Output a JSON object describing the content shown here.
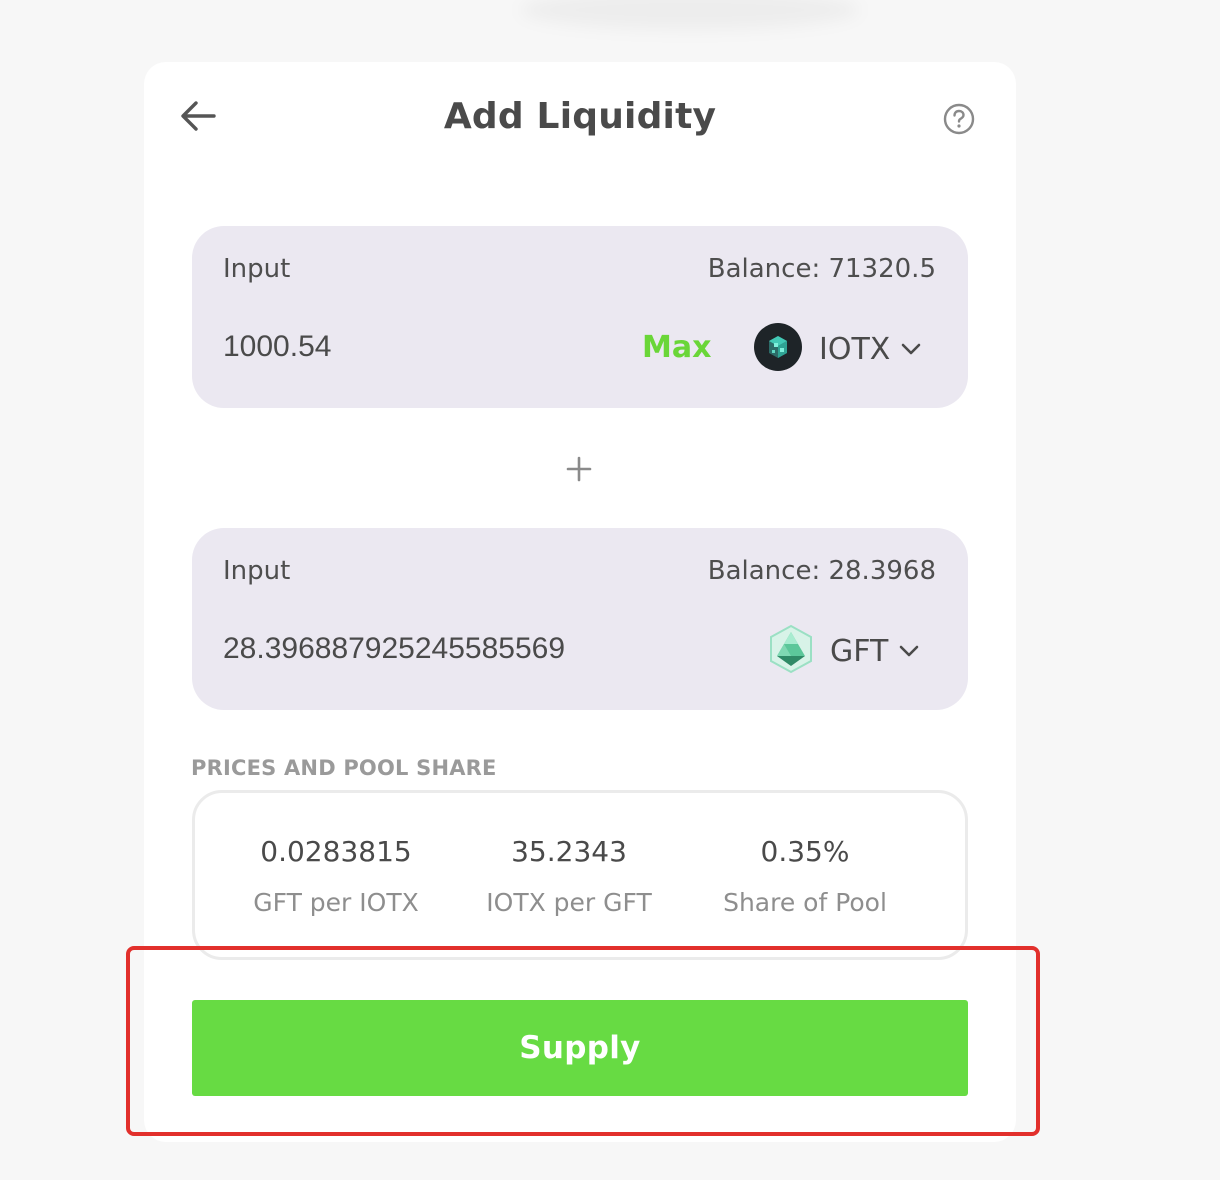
{
  "header": {
    "title": "Add Liquidity",
    "back_icon": "arrow-left-icon",
    "help_icon": "question-circle-icon"
  },
  "input_a": {
    "label": "Input",
    "balance": "Balance: 71320.5",
    "value": "1000.54",
    "max_label": "Max",
    "token": "IOTX",
    "token_icon": "iotx-token-icon"
  },
  "input_b": {
    "label": "Input",
    "balance": "Balance: 28.3968",
    "value": "28.396887925245585569",
    "token": "GFT",
    "token_icon": "gft-token-icon"
  },
  "prices": {
    "section_label": "PRICES AND POOL SHARE",
    "stats": [
      {
        "value": "0.0283815",
        "caption": "GFT per IOTX"
      },
      {
        "value": "35.2343",
        "caption": "IOTX per GFT"
      },
      {
        "value": "0.35%",
        "caption": "Share of Pool"
      }
    ]
  },
  "supply_label": "Supply",
  "colors": {
    "accent_green": "#67db43",
    "max_green": "#6ad638",
    "panel_bg": "#ebe8f1",
    "highlight_red": "#e2302c"
  }
}
